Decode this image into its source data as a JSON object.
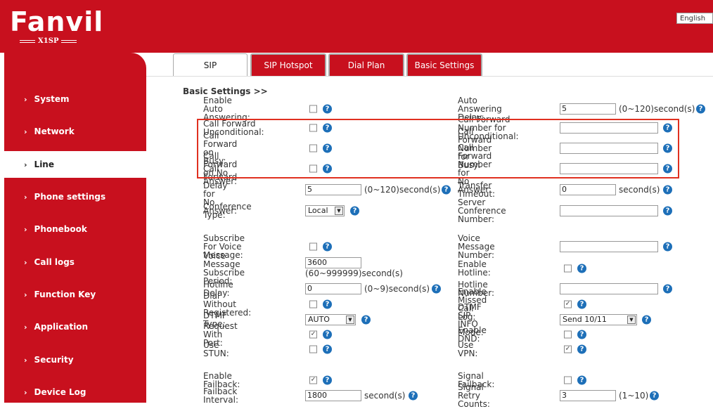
{
  "brand": {
    "logo": "Fanvil",
    "model": "X1SP"
  },
  "language": "English",
  "colors": {
    "brand_red": "#c8101e",
    "help_blue": "#1d6fb8",
    "highlight": "#e03020"
  },
  "sidebar": {
    "items": [
      {
        "label": "System",
        "active": false
      },
      {
        "label": "Network",
        "active": false
      },
      {
        "label": "Line",
        "active": true
      },
      {
        "label": "Phone settings",
        "active": false
      },
      {
        "label": "Phonebook",
        "active": false
      },
      {
        "label": "Call logs",
        "active": false
      },
      {
        "label": "Function Key",
        "active": false
      },
      {
        "label": "Application",
        "active": false
      },
      {
        "label": "Security",
        "active": false
      },
      {
        "label": "Device Log",
        "active": false
      }
    ]
  },
  "tabs": [
    {
      "label": "SIP",
      "active": true
    },
    {
      "label": "SIP Hotspot",
      "active": false
    },
    {
      "label": "Dial Plan",
      "active": false
    },
    {
      "label": "Basic Settings",
      "active": false
    }
  ],
  "section_title": "Basic Settings >>",
  "left": {
    "enable_auto_answering": {
      "label": "Enable Auto Answering:",
      "checked": false
    },
    "cf_unconditional": {
      "label1": "Call Forward",
      "label2": "Unconditional:",
      "checked": false
    },
    "cf_busy": {
      "label": "Call Forward on Busy:",
      "checked": false
    },
    "cf_no_answer": {
      "label1": "Call Forward on No",
      "label2": "Answer:",
      "checked": false
    },
    "cf_delay": {
      "label1": "Call Forward Delay for",
      "label2": "No Answer:",
      "value": "5",
      "unit": "(0~120)second(s)"
    },
    "conference_type": {
      "label": "Conference Type:",
      "value": "Local"
    },
    "subscribe_voice": {
      "label1": "Subscribe For Voice",
      "label2": "Message:",
      "checked": false
    },
    "vm_sub_period": {
      "label1": "Voice Message",
      "label2": "Subscribe Period:",
      "value": "3600",
      "unit": "(60~999999)second(s)"
    },
    "hotline_delay": {
      "label": "Hotline Delay:",
      "value": "0",
      "unit": "(0~9)second(s)"
    },
    "dial_without_reg": {
      "label": "Dial Without Registered:",
      "checked": false
    },
    "dtmf_type": {
      "label": "DTMF Type:",
      "value": "AUTO"
    },
    "request_with_port": {
      "label": "Request With Port:",
      "checked": true
    },
    "use_stun": {
      "label": "Use STUN:",
      "checked": false
    },
    "enable_failback": {
      "label": "Enable Failback:",
      "checked": true
    },
    "failback_interval": {
      "label": "Failback Interval:",
      "value": "1800",
      "unit": "second(s)"
    }
  },
  "right": {
    "auto_answer_delay": {
      "label": "Auto Answering Delay:",
      "value": "5",
      "unit": "(0~120)second(s)"
    },
    "cfn_unconditional": {
      "label1": "Call Forward Number for",
      "label2": "Unconditional:",
      "value": ""
    },
    "cfn_busy": {
      "label1": "Call Forward Number for",
      "label2": "Busy:",
      "value": ""
    },
    "cfn_no_answer": {
      "label1": "Call Forward Number for",
      "label2": "No Answer:",
      "value": ""
    },
    "transfer_timeout": {
      "label": "Transfer Timeout:",
      "value": "0",
      "unit": "second(s)"
    },
    "server_conf_number": {
      "label1": "Server Conference",
      "label2": "Number:",
      "value": ""
    },
    "voice_message_number": {
      "label": "Voice Message Number:",
      "value": ""
    },
    "enable_hotline": {
      "label": "Enable Hotline:",
      "checked": false
    },
    "hotline_number": {
      "label": "Hotline Number:",
      "value": ""
    },
    "enable_missed_call_log": {
      "label": "Enable Missed Call Log:",
      "checked": true
    },
    "dtmf_sip_info_mode": {
      "label": "DTMF SIP INFO Mode:",
      "value": "Send 10/11"
    },
    "enable_dnd": {
      "label": "Enable DND:",
      "checked": false
    },
    "use_vpn": {
      "label": "Use VPN:",
      "checked": true
    },
    "signal_failback": {
      "label": "Signal Failback:",
      "checked": false
    },
    "signal_retry_counts": {
      "label": "Signal Retry Counts:",
      "value": "3",
      "unit": "(1~10)"
    }
  },
  "icons": {
    "help": "help-icon",
    "check": "✓",
    "dropdown": "▼"
  }
}
